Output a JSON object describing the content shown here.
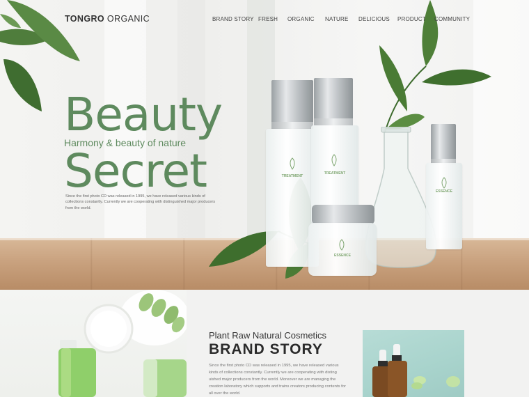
{
  "brand": {
    "bold": "TONGRO",
    "light": "ORGANIC"
  },
  "nav": [
    {
      "label": "BRAND STORY"
    },
    {
      "label": "FRESH"
    },
    {
      "label": "ORGANIC"
    },
    {
      "label": "NATURE"
    },
    {
      "label": "DELICIOUS"
    },
    {
      "label": "PRODUCT"
    },
    {
      "label": "COMMUNITY"
    }
  ],
  "hero": {
    "title_line1": "Beauty",
    "subtitle": "Harmony & beauty of nature",
    "title_line2": "Secret",
    "description": "Since the first photo CD was released in 1995, we have released various kinds of collections constantly. Currently we are cooperating with distinguished major producers from the world."
  },
  "products": {
    "label_treatment": "TREATMENT",
    "label_essence": "ESSENCE"
  },
  "brand_story": {
    "kicker": "Plant Raw Natural Cosmetics",
    "title": "BRAND STORY",
    "description": "Since the first photo CD was released in 1995, we have released various kinds of collections constantly. Currently we are cooperating with disting uished major producers from the world. Moreover we are managing the creation laboratory which supports and trains creators producing contents for all over the world."
  },
  "colors": {
    "accent_green": "#5e8a5e",
    "floor_wood": "#c9a27f",
    "text_dark": "#2b2b2b",
    "panel_teal": "#a8d3cc"
  },
  "icons": {
    "leaf": "leaf-icon"
  }
}
